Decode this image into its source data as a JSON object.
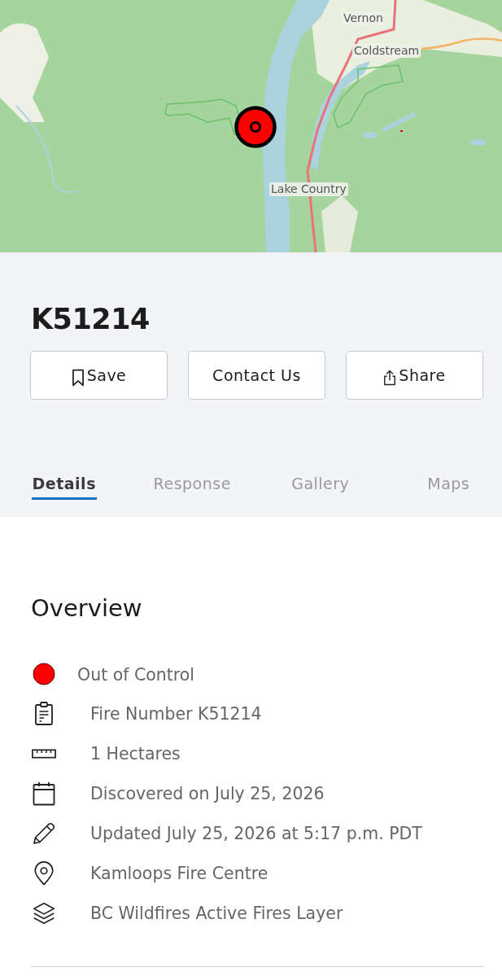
{
  "map": {
    "labels": [
      {
        "text": "Vernon"
      },
      {
        "text": "Coldstream"
      },
      {
        "text": "Lake Country"
      }
    ]
  },
  "header": {
    "title": "K51214",
    "buttons": [
      {
        "kind": "save",
        "label": "Save"
      },
      {
        "kind": "plain",
        "label": "Contact Us"
      },
      {
        "kind": "share",
        "label": "Share"
      }
    ]
  },
  "tabs": [
    {
      "label": "Details",
      "selected": true
    },
    {
      "label": "Response",
      "selected": false
    },
    {
      "label": "Gallery",
      "selected": false
    },
    {
      "label": "Maps",
      "selected": false
    }
  ],
  "overview": {
    "title": "Overview",
    "status": {
      "label": "Out of Control",
      "color": "#ff0000"
    },
    "items": [
      {
        "kind": "fire_number",
        "text": "Fire Number K51214"
      },
      {
        "kind": "size",
        "text": "1 Hectares"
      },
      {
        "kind": "discovered",
        "text": "Discovered on July 25, 2026"
      },
      {
        "kind": "updated",
        "text": "Updated July 25, 2026 at 5:17 p.m. PDT"
      },
      {
        "kind": "fire_centre",
        "text": "Kamloops Fire Centre"
      },
      {
        "kind": "layer",
        "text": "BC Wildfires Active Fires Layer"
      }
    ]
  }
}
